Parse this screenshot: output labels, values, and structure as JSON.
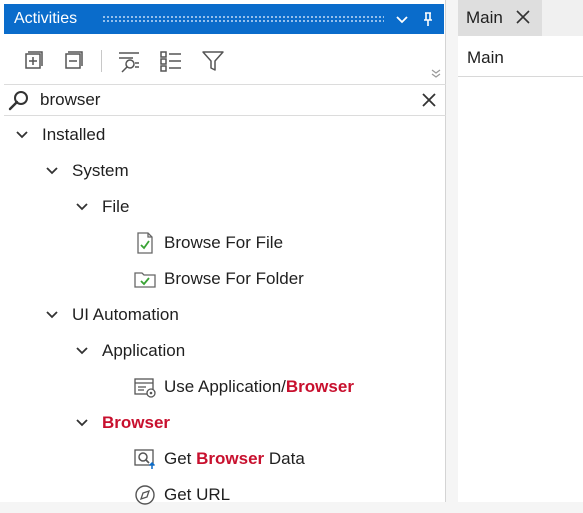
{
  "activities_panel": {
    "title": "Activities",
    "search": {
      "value": "browser"
    }
  },
  "tree": {
    "installed": "Installed",
    "system": "System",
    "file": "File",
    "browse_for_file": "Browse For File",
    "browse_for_folder": "Browse For Folder",
    "ui_automation": "UI Automation",
    "application": "Application",
    "use_application_prefix": "Use Application/",
    "use_application_match": "Browser",
    "browser_category": "Browser",
    "get_browser_data_prefix": "Get ",
    "get_browser_data_match": "Browser",
    "get_browser_data_suffix": " Data",
    "get_url": "Get URL"
  },
  "document": {
    "tab_label": "Main",
    "breadcrumb": "Main"
  },
  "colors": {
    "title_bar": "#0a6ccb",
    "search_match": "#c8102e",
    "check_green": "#3aa335"
  },
  "icons": {
    "title_bar": [
      "chevron-down-icon",
      "pin-icon"
    ],
    "toolbar": [
      "expand-all-icon",
      "collapse-all-icon",
      "show-favorites-icon",
      "list-view-icon",
      "filter-icon"
    ]
  }
}
